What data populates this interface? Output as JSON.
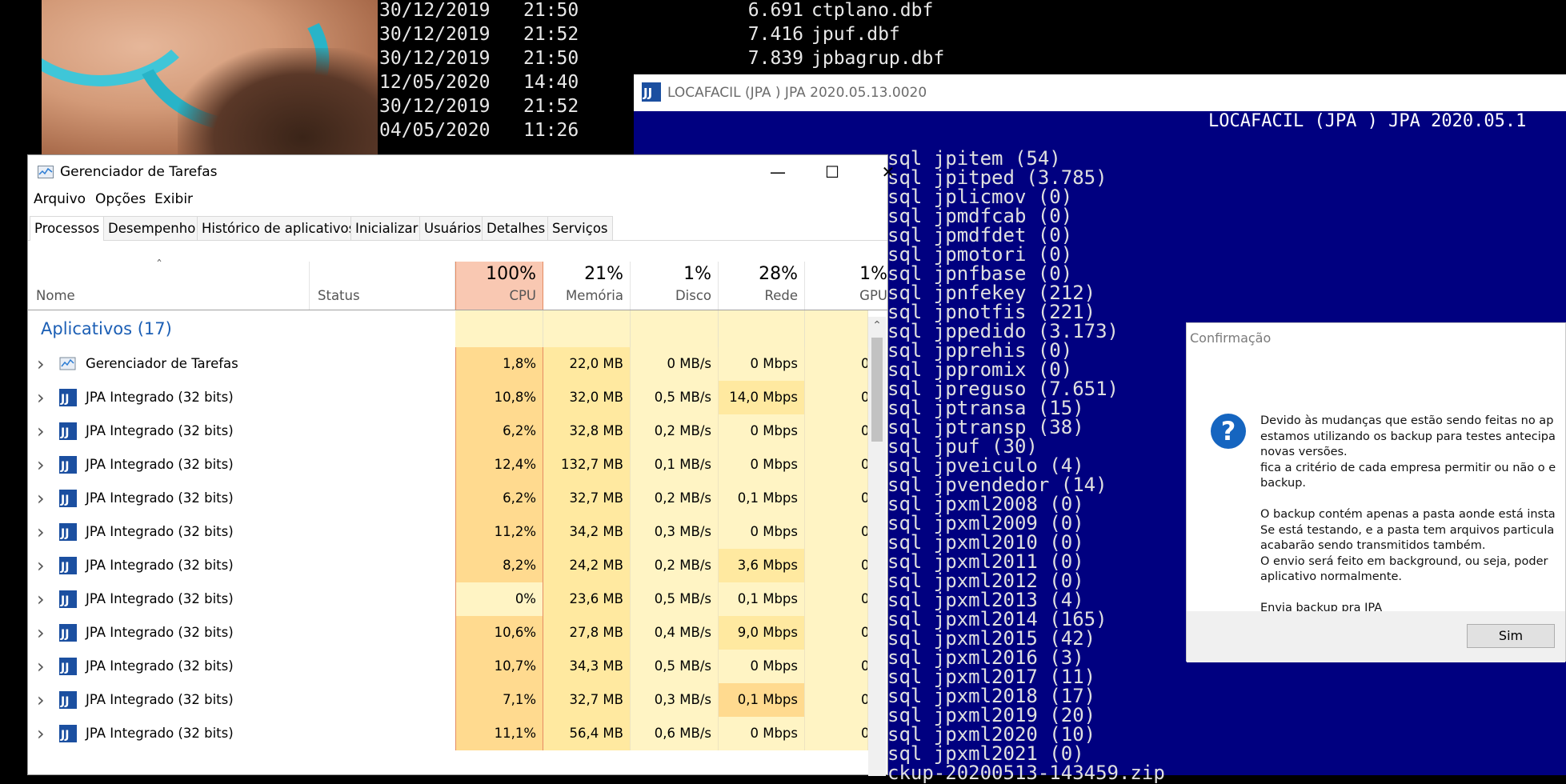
{
  "dos_listing": [
    {
      "date": "30/12/2019",
      "time": "21:50",
      "size": "6.691",
      "file": "ctplano.dbf"
    },
    {
      "date": "30/12/2019",
      "time": "21:52",
      "size": "7.416",
      "file": "jpuf.dbf"
    },
    {
      "date": "30/12/2019",
      "time": "21:50",
      "size": "7.839",
      "file": "jpbagrup.dbf"
    },
    {
      "date": "12/05/2020",
      "time": "14:40",
      "size": "",
      "file": ""
    },
    {
      "date": "30/12/2019",
      "time": "21:52",
      "size": "",
      "file": ""
    },
    {
      "date": "04/05/2020",
      "time": "11:26",
      "size": "",
      "file": ""
    }
  ],
  "jpa": {
    "title": "LOCAFACIL (JPA ) JPA 2020.05.13.0020",
    "bar": "LOCAFACIL (JPA ) JPA 2020.05.1",
    "lines": [
      "sql jpitem (54)",
      "sql jpitped (3.785)",
      "sql jplicmov (0)",
      "sql jpmdfcab (0)",
      "sql jpmdfdet (0)",
      "sql jpmotori (0)",
      "sql jpnfbase (0)",
      "sql jpnfekey (212)",
      "sql jpnotfis (221)",
      "sql jppedido (3.173)",
      "sql jpprehis (0)",
      "sql jppromix (0)",
      "sql jpreguso (7.651)",
      "sql jptransa (15)",
      "sql jptransp (38)",
      "sql jpuf (30)",
      "sql jpveiculo (4)",
      "sql jpvendedor (14)",
      "sql jpxml2008 (0)",
      "sql jpxml2009 (0)",
      "sql jpxml2010 (0)",
      "sql jpxml2011 (0)",
      "sql jpxml2012 (0)",
      "sql jpxml2013 (4)",
      "sql jpxml2014 (165)",
      "sql jpxml2015 (42)",
      "sql jpxml2016 (3)",
      "sql jpxml2017 (11)",
      "sql jpxml2018 (17)",
      "sql jpxml2019 (20)",
      "sql jpxml2020 (10)",
      "sql jpxml2021 (0)",
      "ckup-20200513-143459.zip"
    ]
  },
  "confirm": {
    "title": "Confirmação",
    "paragraphs": [
      "Devido às mudanças que estão sendo feitas no ap",
      "estamos utilizando os backup para testes antecipa",
      "novas versões.",
      "fica a critério de cada empresa permitir ou não o e",
      "backup.",
      "",
      "O backup contém apenas a pasta aonde está insta",
      "Se está testando, e a pasta tem arquivos particula",
      "acabarão sendo transmitidos também.",
      "O envio será feito em background, ou seja, poder",
      "aplicativo normalmente.",
      "",
      "Envia backup pra JPA"
    ],
    "yes_label": "Sim"
  },
  "taskmgr": {
    "title": "Gerenciador de Tarefas",
    "menu": [
      "Arquivo",
      "Opções",
      "Exibir"
    ],
    "tabs": [
      "Processos",
      "Desempenho",
      "Histórico de aplicativos",
      "Inicializar",
      "Usuários",
      "Detalhes",
      "Serviços"
    ],
    "columns": {
      "name": "Nome",
      "status": "Status",
      "cpu_pct": "100%",
      "cpu": "CPU",
      "mem_pct": "21%",
      "mem": "Memória",
      "disk_pct": "1%",
      "disk": "Disco",
      "net_pct": "28%",
      "net": "Rede",
      "gpu_pct": "1%",
      "gpu": "GPU"
    },
    "group": "Aplicativos (17)",
    "rows": [
      {
        "name": "Gerenciador de Tarefas",
        "cpu": "1,8%",
        "mem": "22,0 MB",
        "disk": "0 MB/s",
        "net": "0 Mbps",
        "gpu": "0",
        "icon": "taskmgr-icon"
      },
      {
        "name": "JPA Integrado (32 bits)",
        "cpu": "10,8%",
        "mem": "32,0 MB",
        "disk": "0,5 MB/s",
        "net": "14,0 Mbps",
        "gpu": "0",
        "icon": "jpa-icon"
      },
      {
        "name": "JPA Integrado (32 bits)",
        "cpu": "6,2%",
        "mem": "32,8 MB",
        "disk": "0,2 MB/s",
        "net": "0 Mbps",
        "gpu": "0",
        "icon": "jpa-icon"
      },
      {
        "name": "JPA Integrado (32 bits)",
        "cpu": "12,4%",
        "mem": "132,7 MB",
        "disk": "0,1 MB/s",
        "net": "0 Mbps",
        "gpu": "0",
        "icon": "jpa-icon"
      },
      {
        "name": "JPA Integrado (32 bits)",
        "cpu": "6,2%",
        "mem": "32,7 MB",
        "disk": "0,2 MB/s",
        "net": "0,1 Mbps",
        "gpu": "0",
        "icon": "jpa-icon"
      },
      {
        "name": "JPA Integrado (32 bits)",
        "cpu": "11,2%",
        "mem": "34,2 MB",
        "disk": "0,3 MB/s",
        "net": "0 Mbps",
        "gpu": "0",
        "icon": "jpa-icon"
      },
      {
        "name": "JPA Integrado (32 bits)",
        "cpu": "8,2%",
        "mem": "24,2 MB",
        "disk": "0,2 MB/s",
        "net": "3,6 Mbps",
        "gpu": "0",
        "icon": "jpa-icon"
      },
      {
        "name": "JPA Integrado (32 bits)",
        "cpu": "0%",
        "mem": "23,6 MB",
        "disk": "0,5 MB/s",
        "net": "0,1 Mbps",
        "gpu": "0",
        "icon": "jpa-icon"
      },
      {
        "name": "JPA Integrado (32 bits)",
        "cpu": "10,6%",
        "mem": "27,8 MB",
        "disk": "0,4 MB/s",
        "net": "9,0 Mbps",
        "gpu": "0",
        "icon": "jpa-icon"
      },
      {
        "name": "JPA Integrado (32 bits)",
        "cpu": "10,7%",
        "mem": "34,3 MB",
        "disk": "0,5 MB/s",
        "net": "0 Mbps",
        "gpu": "0",
        "icon": "jpa-icon"
      },
      {
        "name": "JPA Integrado (32 bits)",
        "cpu": "7,1%",
        "mem": "32,7 MB",
        "disk": "0,3 MB/s",
        "net": "0,1 Mbps",
        "gpu": "0",
        "icon": "jpa-icon"
      },
      {
        "name": "JPA Integrado (32 bits)",
        "cpu": "11,1%",
        "mem": "56,4 MB",
        "disk": "0,6 MB/s",
        "net": "0 Mbps",
        "gpu": "0",
        "icon": "jpa-icon"
      }
    ]
  },
  "colors": {
    "cpu_header": "#f9c8b2",
    "cell_light": "#fff4c4",
    "cell_mid": "#ffe9a0",
    "cell_strong": "#ffda8f",
    "jpa_bg": "#000080",
    "link_blue": "#1c5fb5"
  }
}
